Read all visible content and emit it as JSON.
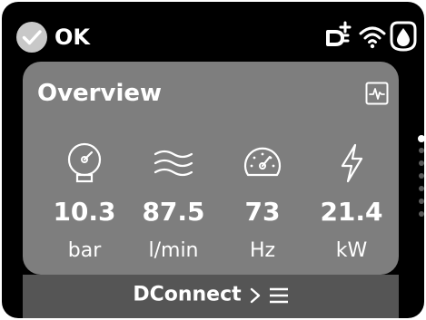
{
  "status": {
    "state_label": "OK",
    "icons": [
      "ok-check-icon",
      "dconnect-plug-icon",
      "wifi-icon",
      "water-drop-icon"
    ]
  },
  "overview": {
    "title": "Overview",
    "chart_button_icon": "pulse-chart-icon",
    "metrics": [
      {
        "icon": "pressure-gauge-icon",
        "value": "10.3",
        "unit": "bar"
      },
      {
        "icon": "flow-waves-icon",
        "value": "87.5",
        "unit": "l/min"
      },
      {
        "icon": "speedometer-icon",
        "value": "73",
        "unit": "Hz"
      },
      {
        "icon": "lightning-icon",
        "value": "21.4",
        "unit": "kW"
      }
    ]
  },
  "bottom_bar": {
    "label": "DConnect",
    "icons": [
      "chevron-right-icon",
      "menu-icon"
    ]
  },
  "page_indicator": {
    "count": 7,
    "active_index": 0
  },
  "colors": {
    "background": "#000000",
    "card": "#7e7e7e",
    "bottom_bar": "#555555",
    "text": "#ffffff",
    "ok_badge": "#c8c8c8"
  }
}
